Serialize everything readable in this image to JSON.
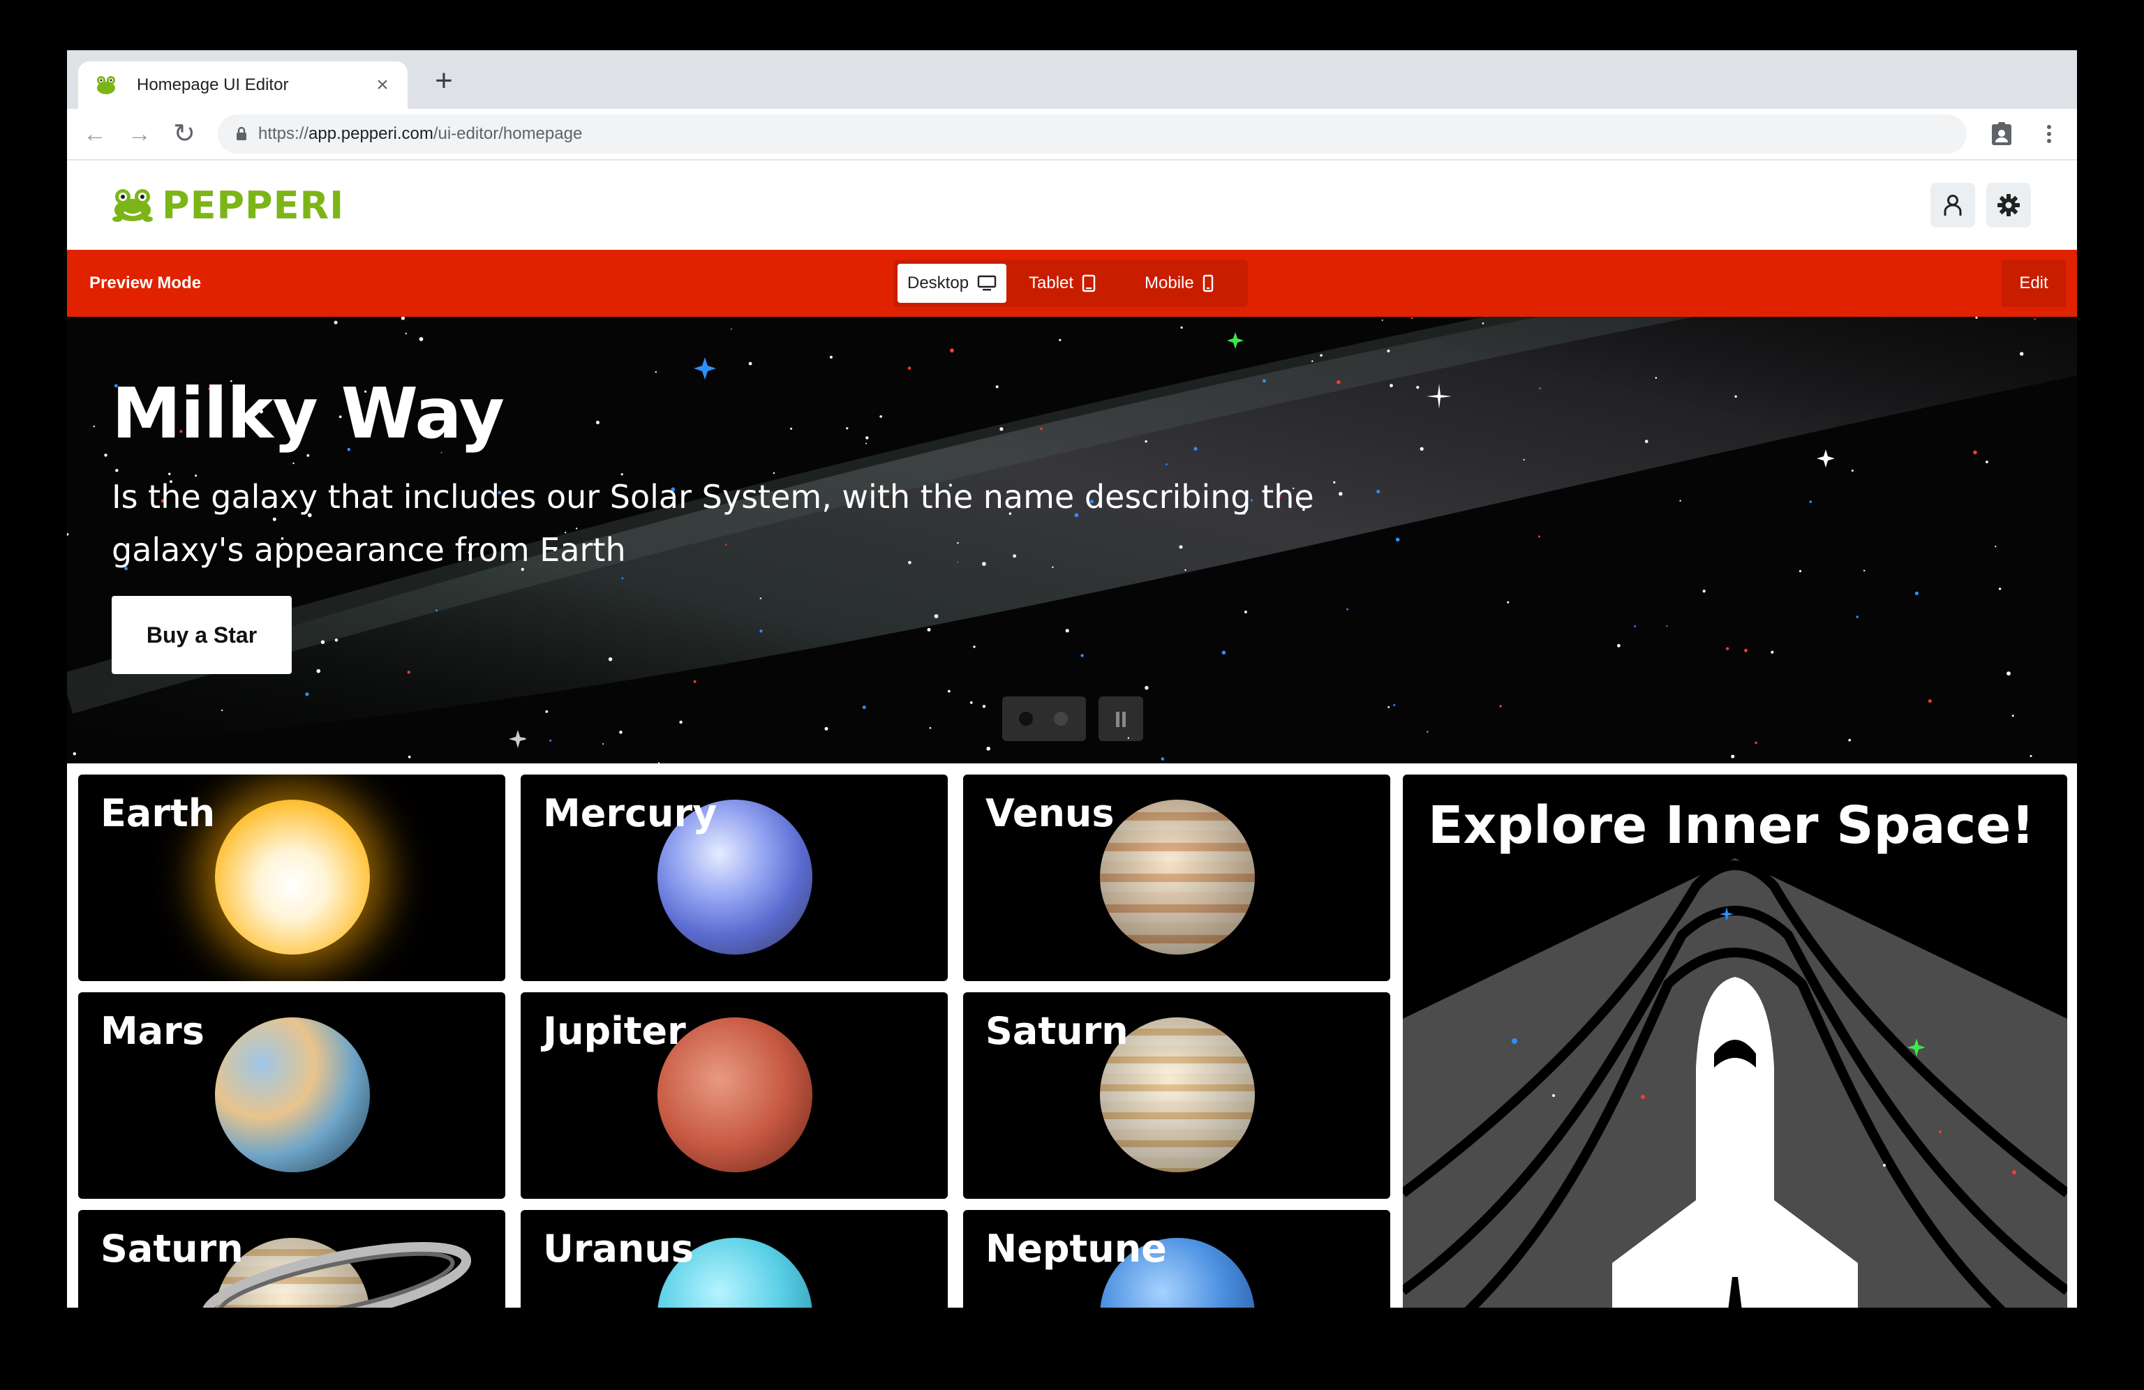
{
  "browser": {
    "tab_title": "Homepage UI Editor",
    "tab_close": "×",
    "new_tab": "+",
    "url_scheme": "https://",
    "url_host": "app.pepperi.com",
    "url_path": "/ui-editor/homepage"
  },
  "app": {
    "logo_text": "PEPPERI",
    "brand_color": "#7cb518"
  },
  "preview_bar": {
    "label": "Preview Mode",
    "devices": [
      {
        "label": "Desktop",
        "icon": "monitor-icon",
        "active": true
      },
      {
        "label": "Tablet",
        "icon": "tablet-icon",
        "active": false
      },
      {
        "label": "Mobile",
        "icon": "phone-icon",
        "active": false
      }
    ],
    "edit_label": "Edit",
    "color": "#e02200"
  },
  "hero": {
    "title": "Milky Way",
    "text": "Is the galaxy that includes our Solar System, with the name describing the galaxy's appearance from Earth",
    "button": "Buy a Star",
    "slides_active": 1,
    "slides_total": 2
  },
  "tiles": [
    {
      "label": "Earth",
      "planet": "sun"
    },
    {
      "label": "Mercury",
      "planet": "blue-marbled"
    },
    {
      "label": "Venus",
      "planet": "banded-tan"
    },
    {
      "label": "Mars",
      "planet": "earthlike"
    },
    {
      "label": "Jupiter",
      "planet": "red"
    },
    {
      "label": "Saturn",
      "planet": "banded-cream"
    },
    {
      "label": "Saturn",
      "planet": "ringed"
    },
    {
      "label": "Uranus",
      "planet": "cyan"
    },
    {
      "label": "Neptune",
      "planet": "blue"
    }
  ],
  "promo": {
    "title": "Explore Inner Space!"
  }
}
